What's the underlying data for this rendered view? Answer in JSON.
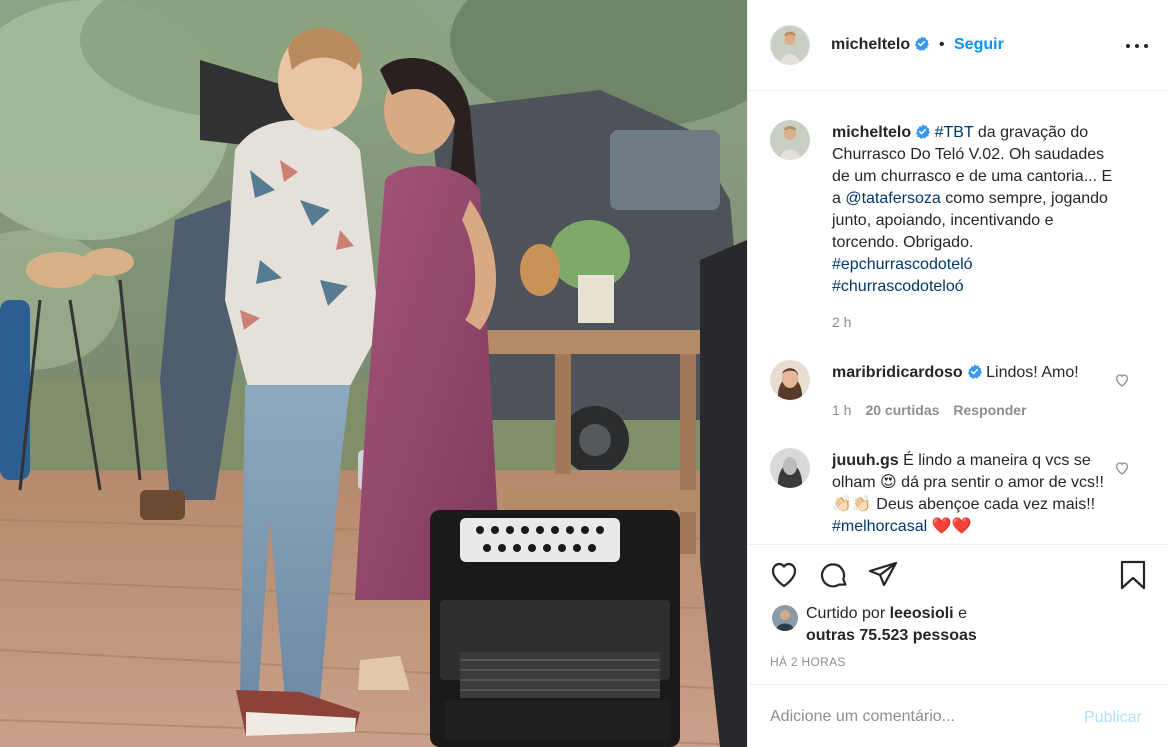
{
  "header": {
    "username": "micheltelo",
    "separator": "•",
    "follow_label": "Seguir"
  },
  "caption": {
    "username": "micheltelo",
    "hashtag_tbt": "#TBT",
    "text_1": " da gravação do Churrasco Do Teló V.02. Oh saudades de um churrasco e de uma cantoria... E a ",
    "mention": "@tatafersoza",
    "text_2": " como sempre, jogando junto, apoiando, incentivando e torcendo. Obrigado.",
    "hashtag_1": "#epchurrascodoteló",
    "hashtag_2": "#churrascodoteloó",
    "time": "2 h"
  },
  "comments": [
    {
      "username": "maribridicardoso",
      "verified": true,
      "text": "Lindos! Amo!",
      "time": "1 h",
      "likes": "20 curtidas",
      "reply": "Responder"
    },
    {
      "username": "juuuh.gs",
      "verified": false,
      "text_1": "É lindo a maneira q vcs se olham ",
      "emoji_1": "😍",
      "text_2": " dá pra sentir o amor de vcs!! ",
      "emoji_2": "👏🏻👏🏻",
      "text_3": " Deus abençoe cada vez mais!! ",
      "hashtag": "#melhorcasal",
      "emoji_3": "❤️❤️"
    }
  ],
  "likes": {
    "prefix": "Curtido por ",
    "user": "leeosioli",
    "middle": " e",
    "others": "outras 75.523 pessoas"
  },
  "timestamp": "HÁ 2 HORAS",
  "add_comment": {
    "placeholder": "Adicione um comentário...",
    "post_label": "Publicar"
  },
  "icons": {
    "verified": "verified-badge-icon",
    "like": "heart-icon",
    "comment": "comment-icon",
    "share": "paper-plane-icon",
    "save": "bookmark-icon",
    "more": "more-options-icon"
  },
  "colors": {
    "link_blue": "#0095f6",
    "hashtag": "#00376b",
    "muted": "#8e8e8e",
    "post_disabled": "#b2dffc",
    "verified_blue": "#3897f0"
  }
}
